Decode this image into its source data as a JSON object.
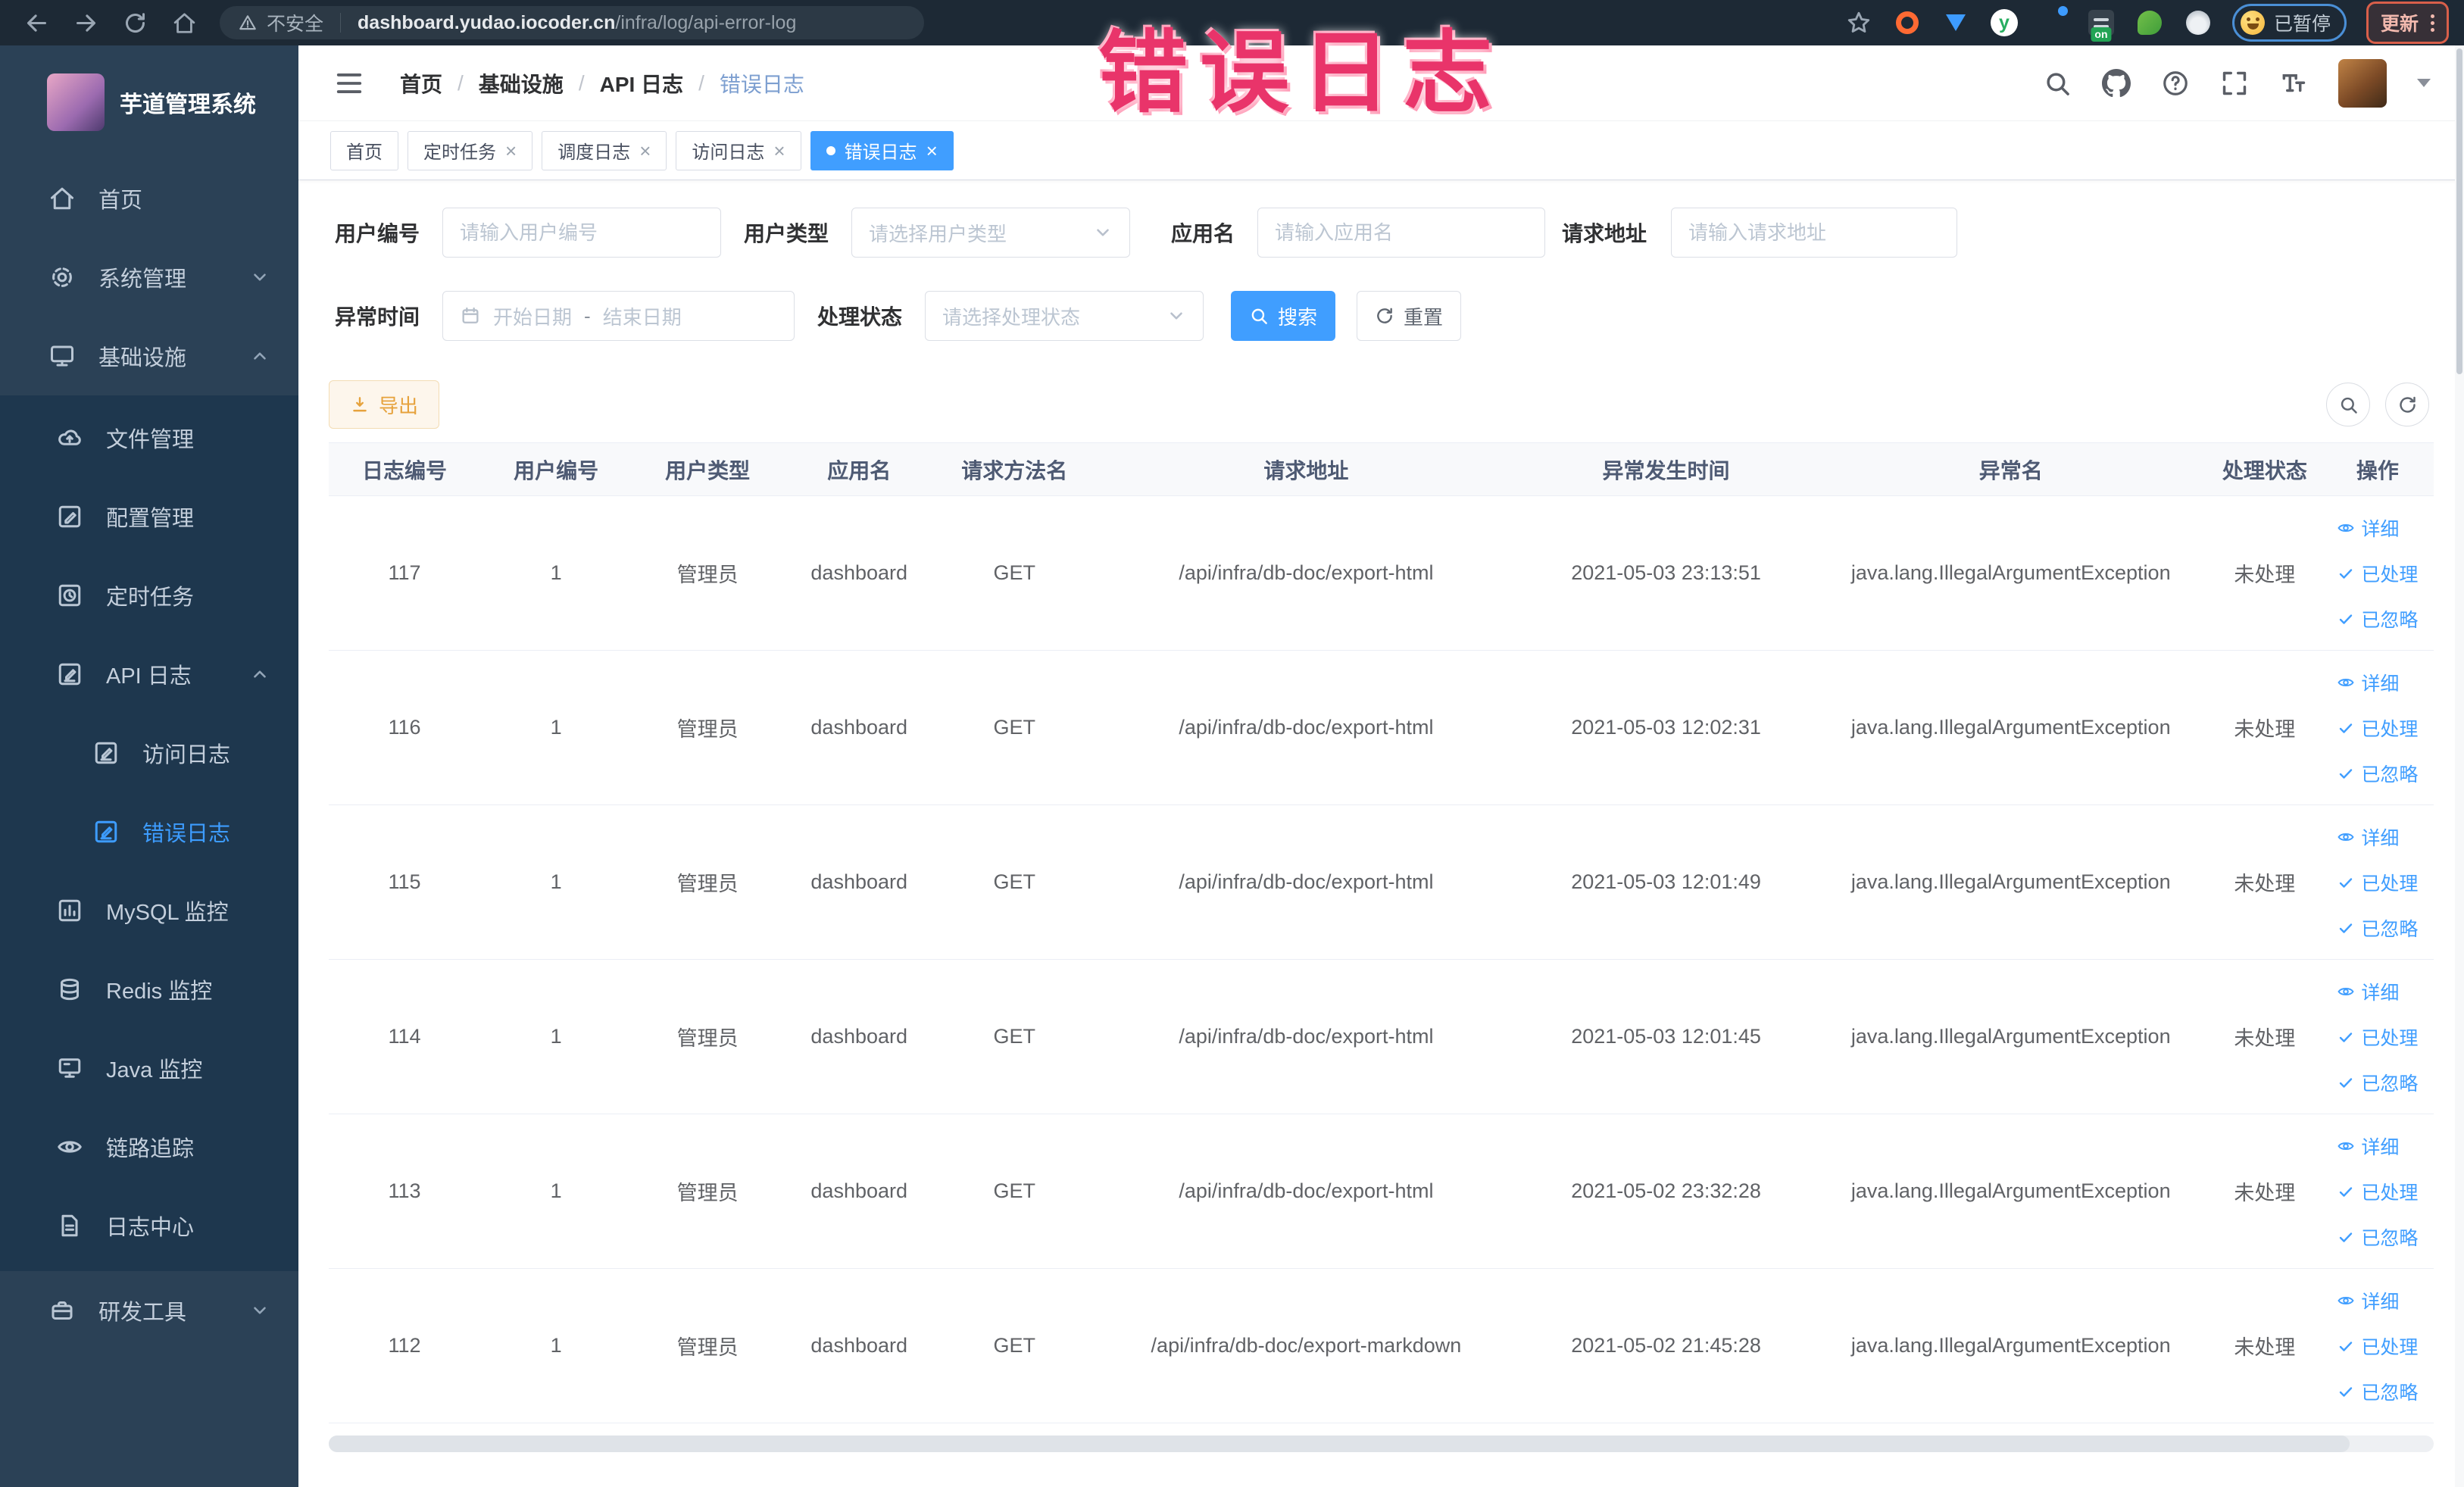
{
  "browser": {
    "security_label": "不安全",
    "url_domain": "dashboard.yudao.iocoder.cn",
    "url_path": "/infra/log/api-error-log",
    "ext_y_letter": "y",
    "on_badge": "on",
    "paused_label": "已暂停",
    "update_label": "更新"
  },
  "annotation": {
    "text": "错误日志",
    "color": "#e9346a"
  },
  "sidebar": {
    "title": "芋道管理系统",
    "items": [
      {
        "label": "首页"
      },
      {
        "label": "系统管理"
      },
      {
        "label": "基础设施"
      },
      {
        "label": "文件管理"
      },
      {
        "label": "配置管理"
      },
      {
        "label": "定时任务"
      },
      {
        "label": "API 日志"
      },
      {
        "label": "访问日志"
      },
      {
        "label": "错误日志"
      },
      {
        "label": "MySQL 监控"
      },
      {
        "label": "Redis 监控"
      },
      {
        "label": "Java 监控"
      },
      {
        "label": "链路追踪"
      },
      {
        "label": "日志中心"
      },
      {
        "label": "研发工具"
      }
    ]
  },
  "header": {
    "breadcrumb": [
      "首页",
      "基础设施",
      "API 日志",
      "错误日志"
    ],
    "separator": "/"
  },
  "tabs": [
    {
      "label": "首页"
    },
    {
      "label": "定时任务"
    },
    {
      "label": "调度日志"
    },
    {
      "label": "访问日志"
    },
    {
      "label": "错误日志"
    }
  ],
  "icons": {
    "close": "×"
  },
  "filters": {
    "user_id": {
      "label": "用户编号",
      "placeholder": "请输入用户编号"
    },
    "user_type": {
      "label": "用户类型",
      "placeholder": "请选择用户类型"
    },
    "app_name": {
      "label": "应用名",
      "placeholder": "请输入应用名"
    },
    "request_url": {
      "label": "请求地址",
      "placeholder": "请输入请求地址"
    },
    "exception_time": {
      "label": "异常时间",
      "start_placeholder": "开始日期",
      "separator": "-",
      "end_placeholder": "结束日期"
    },
    "process_status": {
      "label": "处理状态",
      "placeholder": "请选择处理状态"
    },
    "search_label": "搜索",
    "reset_label": "重置"
  },
  "toolbar": {
    "export_label": "导出"
  },
  "table": {
    "headers": [
      "日志编号",
      "用户编号",
      "用户类型",
      "应用名",
      "请求方法名",
      "请求地址",
      "异常发生时间",
      "异常名",
      "处理状态",
      "操作"
    ],
    "actions": {
      "detail": "详细",
      "processed": "已处理",
      "ignored": "已忽略"
    },
    "rows": [
      {
        "id": "117",
        "user_id": "1",
        "user_type": "管理员",
        "app": "dashboard",
        "method": "GET",
        "url": "/api/infra/db-doc/export-html",
        "time": "2021-05-03 23:13:51",
        "exception": "java.lang.IllegalArgumentException",
        "status": "未处理"
      },
      {
        "id": "116",
        "user_id": "1",
        "user_type": "管理员",
        "app": "dashboard",
        "method": "GET",
        "url": "/api/infra/db-doc/export-html",
        "time": "2021-05-03 12:02:31",
        "exception": "java.lang.IllegalArgumentException",
        "status": "未处理"
      },
      {
        "id": "115",
        "user_id": "1",
        "user_type": "管理员",
        "app": "dashboard",
        "method": "GET",
        "url": "/api/infra/db-doc/export-html",
        "time": "2021-05-03 12:01:49",
        "exception": "java.lang.IllegalArgumentException",
        "status": "未处理"
      },
      {
        "id": "114",
        "user_id": "1",
        "user_type": "管理员",
        "app": "dashboard",
        "method": "GET",
        "url": "/api/infra/db-doc/export-html",
        "time": "2021-05-03 12:01:45",
        "exception": "java.lang.IllegalArgumentException",
        "status": "未处理"
      },
      {
        "id": "113",
        "user_id": "1",
        "user_type": "管理员",
        "app": "dashboard",
        "method": "GET",
        "url": "/api/infra/db-doc/export-html",
        "time": "2021-05-02 23:32:28",
        "exception": "java.lang.IllegalArgumentException",
        "status": "未处理"
      },
      {
        "id": "112",
        "user_id": "1",
        "user_type": "管理员",
        "app": "dashboard",
        "method": "GET",
        "url": "/api/infra/db-doc/export-markdown",
        "time": "2021-05-02 21:45:28",
        "exception": "java.lang.IllegalArgumentException",
        "status": "未处理"
      }
    ]
  },
  "colors": {
    "primary": "#409eff",
    "warning": "#e6a23c",
    "annotation_pink": "#e9346a",
    "sidebar_bg": "#2b4156",
    "submenu_bg": "#1e374e",
    "browser_bar_bg": "#1d2935"
  }
}
